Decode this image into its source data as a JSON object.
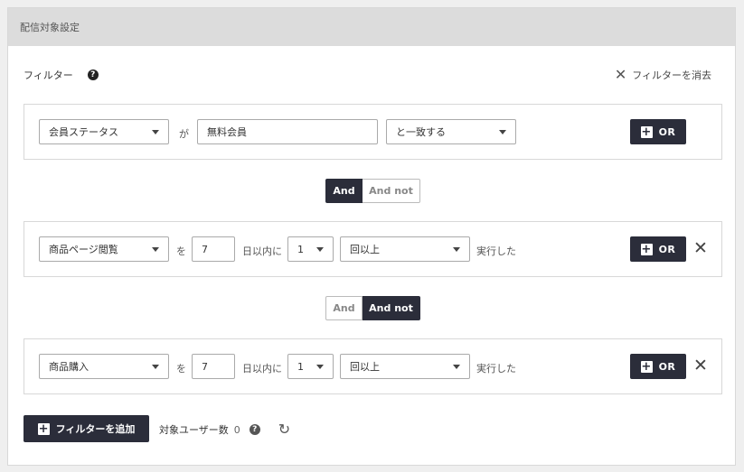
{
  "panel": {
    "title": "配信対象設定"
  },
  "filter": {
    "label": "フィルター",
    "clear_label": "フィルターを消去"
  },
  "rule1": {
    "field": "会員ステータス",
    "particle": "が",
    "value": "無料会員",
    "operator": "と一致する",
    "or_label": "OR"
  },
  "toggle1": {
    "and": "And",
    "and_not": "And not",
    "selected": "And"
  },
  "rule2": {
    "field": "商品ページ閲覧",
    "particle": "を",
    "days": "7",
    "days_suffix": "日以内に",
    "count": "1",
    "count_op": "回以上",
    "suffix": "実行した",
    "or_label": "OR"
  },
  "toggle2": {
    "and": "And",
    "and_not": "And not",
    "selected": "And not"
  },
  "rule3": {
    "field": "商品購入",
    "particle": "を",
    "days": "7",
    "days_suffix": "日以内に",
    "count": "1",
    "count_op": "回以上",
    "suffix": "実行した",
    "or_label": "OR"
  },
  "footer": {
    "add_filter_label": "フィルターを追加",
    "target_users_label": "対象ユーザー数",
    "target_users_count": "0"
  },
  "icons": {
    "help": "question-circle-icon",
    "close": "close-icon",
    "plus": "plus-square-icon",
    "caret": "caret-down-icon",
    "refresh": "refresh-icon"
  },
  "colors": {
    "dark_button": "#2b2d3a",
    "header_bg": "#dcdcdc"
  }
}
